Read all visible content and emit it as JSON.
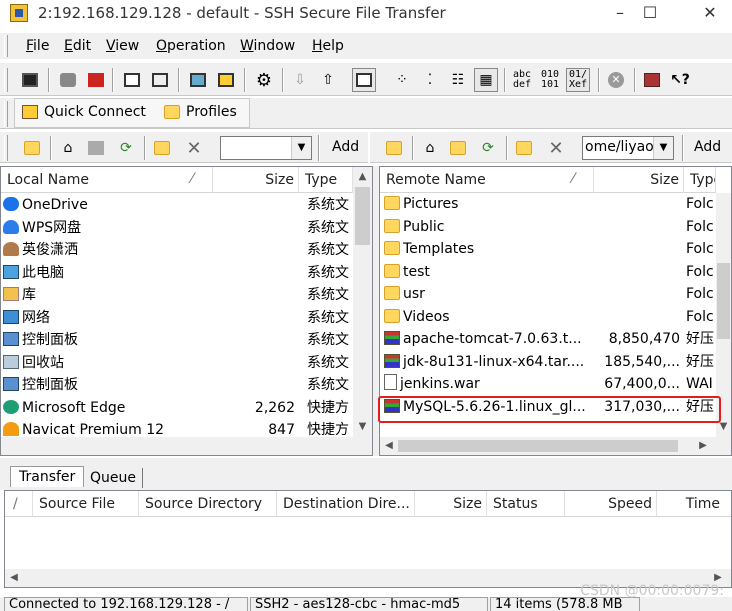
{
  "window": {
    "title": "2:192.168.129.128 - default - SSH Secure File Transfer",
    "controls": [
      "–",
      "☐",
      "✕"
    ]
  },
  "menu": [
    {
      "key": "F",
      "rest": "ile"
    },
    {
      "key": "E",
      "rest": "dit"
    },
    {
      "key": "V",
      "rest": "iew"
    },
    {
      "key": "O",
      "rest": "peration"
    },
    {
      "key": "W",
      "rest": "indow"
    },
    {
      "key": "H",
      "rest": "elp"
    }
  ],
  "quickbar": {
    "quick_connect": "Quick Connect",
    "profiles": "Profiles"
  },
  "toolbar": {
    "abc_label": "abc\ndef",
    "bin_label": "010\n101",
    "auto_label": "01/\nXef"
  },
  "local": {
    "add_label": "Add",
    "path_value": "",
    "columns": [
      "Local Name",
      "Size",
      "Type"
    ],
    "rows": [
      {
        "name": "OneDrive",
        "size": "",
        "type": "系统文",
        "icon": "cloud-icon"
      },
      {
        "name": "WPS网盘",
        "size": "",
        "type": "系统文",
        "icon": "wps-cloud-icon"
      },
      {
        "name": "英俊潇洒",
        "size": "",
        "type": "系统文",
        "icon": "user-icon"
      },
      {
        "name": "此电脑",
        "size": "",
        "type": "系统文",
        "icon": "computer-icon"
      },
      {
        "name": "库",
        "size": "",
        "type": "系统文",
        "icon": "library-icon"
      },
      {
        "name": "网络",
        "size": "",
        "type": "系统文",
        "icon": "network-icon"
      },
      {
        "name": "控制面板",
        "size": "",
        "type": "系统文",
        "icon": "control-panel-icon"
      },
      {
        "name": "回收站",
        "size": "",
        "type": "系统文",
        "icon": "recycle-bin-icon"
      },
      {
        "name": "控制面板",
        "size": "",
        "type": "系统文",
        "icon": "control-panel-icon"
      },
      {
        "name": "Microsoft Edge",
        "size": "2,262",
        "type": "快捷方",
        "icon": "edge-icon"
      },
      {
        "name": "Navicat Premium 12",
        "size": "847",
        "type": "快捷方",
        "icon": "navicat-icon"
      }
    ]
  },
  "remote": {
    "add_label": "Add",
    "path_value": "ome/liyao",
    "columns": [
      "Remote Name",
      "Size",
      "Type"
    ],
    "rows": [
      {
        "name": "Pictures",
        "size": "",
        "type": "Folc",
        "icon": "folder-icon"
      },
      {
        "name": "Public",
        "size": "",
        "type": "Folc",
        "icon": "folder-icon"
      },
      {
        "name": "Templates",
        "size": "",
        "type": "Folc",
        "icon": "folder-icon"
      },
      {
        "name": "test",
        "size": "",
        "type": "Folc",
        "icon": "folder-icon"
      },
      {
        "name": "usr",
        "size": "",
        "type": "Folc",
        "icon": "folder-icon"
      },
      {
        "name": "Videos",
        "size": "",
        "type": "Folc",
        "icon": "folder-icon"
      },
      {
        "name": "apache-tomcat-7.0.63.t...",
        "size": "8,850,470",
        "type": "好压",
        "icon": "archive-icon"
      },
      {
        "name": "jdk-8u131-linux-x64.tar....",
        "size": "185,540,...",
        "type": "好压",
        "icon": "archive-icon"
      },
      {
        "name": "jenkins.war",
        "size": "67,400,0...",
        "type": "WAI",
        "icon": "file-icon"
      },
      {
        "name": "MySQL-5.6.26-1.linux_gl...",
        "size": "317,030,...",
        "type": "好压",
        "icon": "archive-icon"
      }
    ]
  },
  "transfer": {
    "tabs": [
      "Transfer",
      "Queue"
    ],
    "columns": [
      "/",
      "Source File",
      "Source Directory",
      "Destination Dire...",
      "Size",
      "Status",
      "Speed",
      "Time"
    ]
  },
  "status": {
    "connection": "Connected to 192.168.129.128 - /",
    "cipher": "SSH2 - aes128-cbc - hmac-md5",
    "items": "14 items (578.8 MB"
  },
  "watermark": "CSDN @00:00:0079:",
  "colors": {
    "highlight": "#e02020",
    "folder": "#ffd75e"
  }
}
